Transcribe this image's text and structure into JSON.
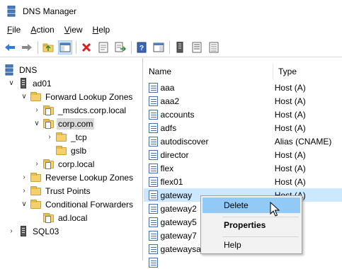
{
  "window": {
    "title": "DNS Manager",
    "icon": "dns-manager-icon"
  },
  "menu": [
    {
      "label": "File",
      "u": "F",
      "rest": "ile"
    },
    {
      "label": "Action",
      "u": "A",
      "rest": "ction"
    },
    {
      "label": "View",
      "u": "V",
      "rest": "iew"
    },
    {
      "label": "Help",
      "u": "H",
      "rest": "elp"
    }
  ],
  "toolbar": [
    "back-icon",
    "forward-icon",
    "up-folder-icon",
    "show-hide-tree-icon",
    "delete-icon",
    "properties-icon",
    "export-list-icon",
    "help-icon",
    "console-icon",
    "server-icon",
    "list-icon",
    "details-icon"
  ],
  "tree": {
    "items": [
      {
        "label": "DNS",
        "level": 0,
        "chevron": "",
        "icon": "dns-icon"
      },
      {
        "label": "ad01",
        "level": 1,
        "chevron": "open",
        "icon": "server-icon"
      },
      {
        "label": "Forward Lookup Zones",
        "level": 2,
        "chevron": "open",
        "icon": "folder-icon"
      },
      {
        "label": "_msdcs.corp.local",
        "level": 3,
        "chevron": "closed",
        "icon": "zone-icon"
      },
      {
        "label": "corp.com",
        "level": 3,
        "chevron": "open",
        "icon": "zone-icon",
        "selected": true
      },
      {
        "label": "_tcp",
        "level": 4,
        "chevron": "closed",
        "icon": "folder-icon"
      },
      {
        "label": "gslb",
        "level": 4,
        "chevron": "",
        "icon": "folder-icon"
      },
      {
        "label": "corp.local",
        "level": 3,
        "chevron": "closed",
        "icon": "zone-icon"
      },
      {
        "label": "Reverse Lookup Zones",
        "level": 2,
        "chevron": "closed",
        "icon": "folder-icon"
      },
      {
        "label": "Trust Points",
        "level": 2,
        "chevron": "closed",
        "icon": "folder-icon"
      },
      {
        "label": "Conditional Forwarders",
        "level": 2,
        "chevron": "open",
        "icon": "folder-icon"
      },
      {
        "label": "ad.local",
        "level": 3,
        "chevron": "",
        "icon": "zone-icon"
      },
      {
        "label": "SQL03",
        "level": 1,
        "chevron": "closed",
        "icon": "server-icon"
      }
    ]
  },
  "list": {
    "columns": {
      "name": "Name",
      "type": "Type"
    },
    "rows": [
      {
        "name": "aaa",
        "type": "Host (A)"
      },
      {
        "name": "aaa2",
        "type": "Host (A)"
      },
      {
        "name": "accounts",
        "type": "Host (A)"
      },
      {
        "name": "adfs",
        "type": "Host (A)"
      },
      {
        "name": "autodiscover",
        "type": "Alias (CNAME)"
      },
      {
        "name": "director",
        "type": "Host (A)"
      },
      {
        "name": "flex",
        "type": "Host (A)"
      },
      {
        "name": "flex01",
        "type": "Host (A)"
      },
      {
        "name": "gateway",
        "type": "Host (A)",
        "selected": true
      },
      {
        "name": "gateway2",
        "type": ""
      },
      {
        "name": "gateway5",
        "type": ""
      },
      {
        "name": "gateway7",
        "type": ""
      },
      {
        "name": "gatewaysa",
        "type": ""
      },
      {
        "name": "",
        "type": ""
      }
    ]
  },
  "context_menu": {
    "items": [
      {
        "label": "Delete",
        "hover": true
      },
      {
        "label": "Properties",
        "bold": true
      },
      {
        "label": "Help"
      }
    ]
  }
}
